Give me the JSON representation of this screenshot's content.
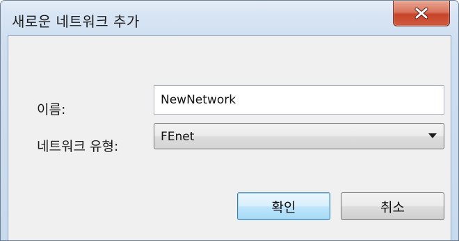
{
  "window": {
    "title": "새로운 네트워크 추가",
    "close_icon": "close-icon"
  },
  "form": {
    "name_label": "이름:",
    "name_value": "NewNetwork",
    "type_label": "네트워크 유형:",
    "type_selected": "FEnet",
    "type_icon": "chevron-down-icon"
  },
  "buttons": {
    "ok_label": "확인",
    "cancel_label": "취소"
  },
  "colors": {
    "close_button": "#c7442a",
    "default_button_border": "#3c7fb1",
    "frame": "#c8daee",
    "client": "#f0f0f0"
  }
}
